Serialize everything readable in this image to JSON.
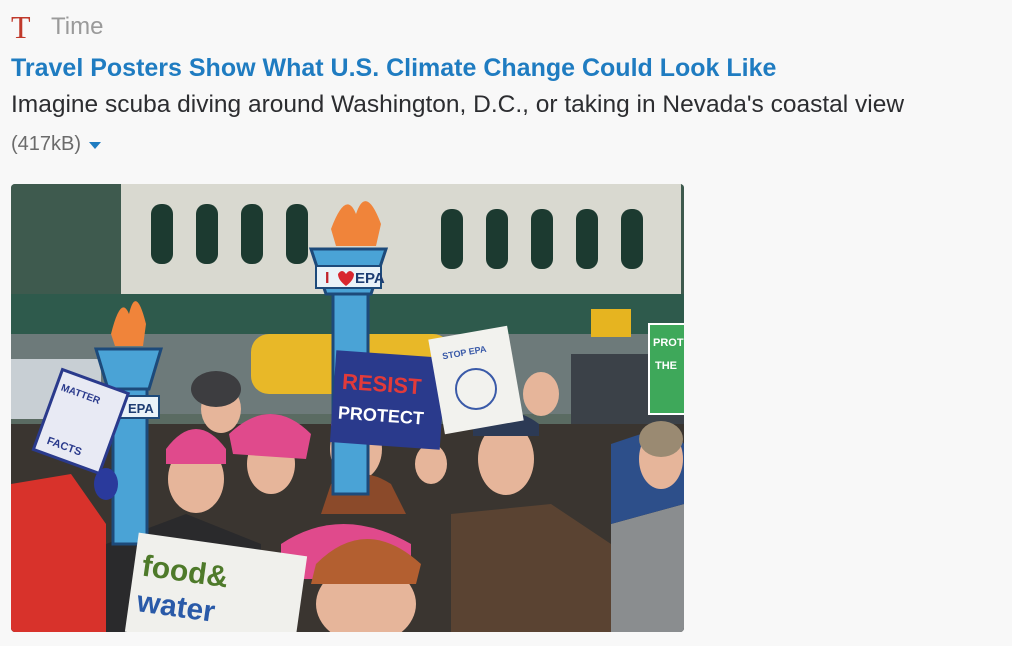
{
  "source": {
    "logo_letter": "T",
    "name": "Time"
  },
  "article": {
    "title": "Travel Posters Show What U.S. Climate Change Could Look Like",
    "description": "Imagine scuba diving around Washington, D.C., or taking in Nevada's coastal view",
    "file_size": "(417kB)"
  },
  "photo": {
    "sign_resist": "RESIST",
    "sign_protect": "PROTECT",
    "sign_epa": "EPA",
    "sign_food": "food&",
    "sign_water": "water",
    "sign_facts": "FACTS",
    "sign_matter": "MATTER",
    "sign_prot": "PROT",
    "sign_the": "THE",
    "sign_stop": "STOP EPA"
  },
  "colors": {
    "link": "#1f7cc1",
    "logo": "#c0392b"
  }
}
